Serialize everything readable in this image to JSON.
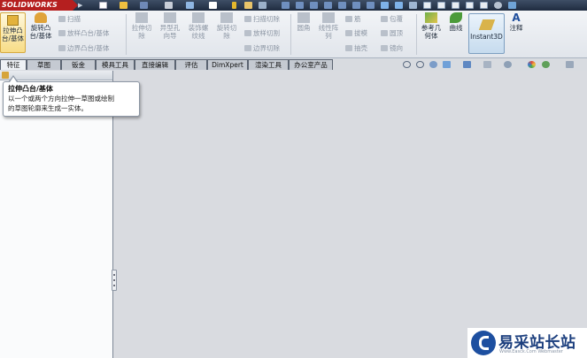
{
  "app": {
    "logo_text": "SOLIDWORKS"
  },
  "ribbon": {
    "extrude_boss": "拉伸凸\n台/基体",
    "revolve_boss": "旋转凸\n台/基体",
    "sweep": "扫描",
    "loft_boss": "放样凸台/基体",
    "boundary_boss": "边界凸台/基体",
    "extrude_cut": "拉伸切\n除",
    "hole_wizard": "异型孔\n向导",
    "revolve_cut_thread": "装饰螺\n纹线",
    "revolve_cut": "旋转切\n除",
    "swept_cut": "扫描切除",
    "lofted_cut": "放样切割",
    "boundary_cut": "边界切除",
    "fillet": "圆角",
    "linear_pattern": "线性阵\n列",
    "rib": "筋",
    "draft": "拔模",
    "shell": "抽壳",
    "wrap": "包覆",
    "dome": "圆顶",
    "mirror": "镜向",
    "ref_geometry": "参考几\n何体",
    "curves": "曲线",
    "instant3d": "Instant3D",
    "annotation": "注释"
  },
  "tabs": [
    {
      "label": "特征",
      "active": true
    },
    {
      "label": "草图",
      "active": false
    },
    {
      "label": "钣金",
      "active": false
    },
    {
      "label": "模具工具",
      "active": false
    },
    {
      "label": "直接编辑",
      "active": false
    },
    {
      "label": "评估",
      "active": false
    },
    {
      "label": "DimXpert",
      "active": false
    },
    {
      "label": "渲染工具",
      "active": false
    },
    {
      "label": "办公室产品",
      "active": false
    }
  ],
  "tooltip": {
    "title": "拉伸凸台/基体",
    "line1": "以一个或两个方向拉伸一草图或绘制",
    "line2": "的草图轮廓来生成一实体。"
  },
  "watermark": {
    "title": "易采站长站",
    "subtitle": "Www.Easck.Com Webmaster"
  },
  "colors": {
    "logo_red": "#b51f1f",
    "graphics_bg": "#d9dbe0",
    "watermark_blue": "#1c3f7e"
  }
}
